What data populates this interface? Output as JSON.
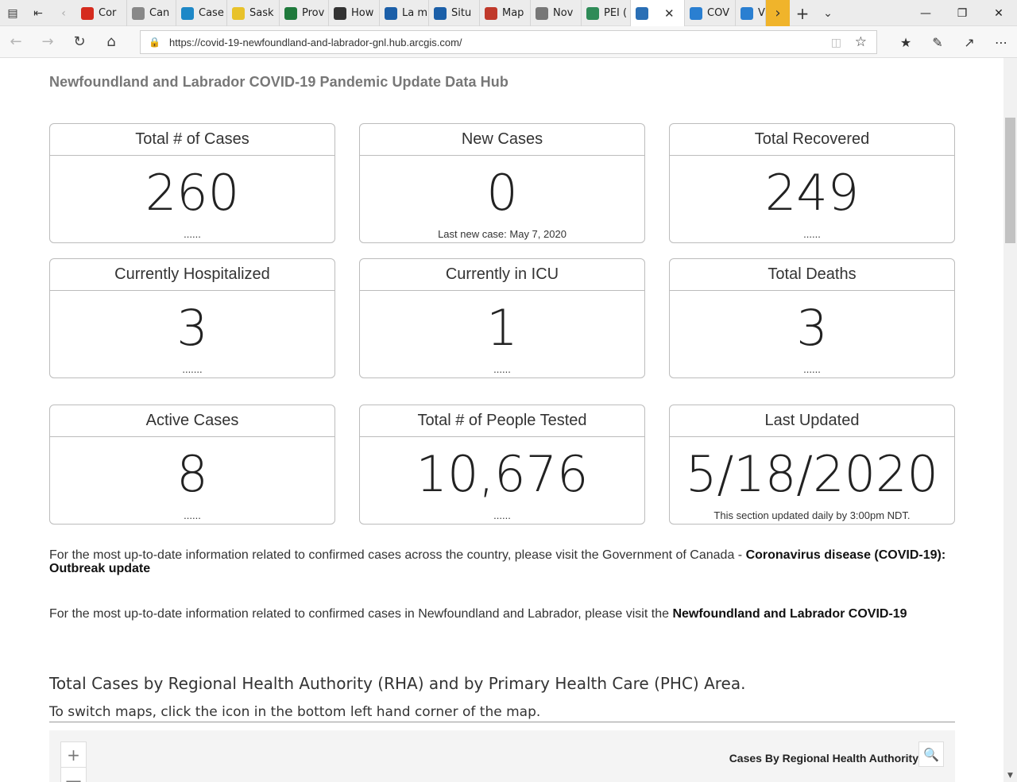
{
  "browser": {
    "tabs": [
      {
        "label": "Cor",
        "icon": "maple-leaf-icon",
        "color": "#d52b1e"
      },
      {
        "label": "Can",
        "icon": "page-icon",
        "color": "#888888"
      },
      {
        "label": "Case",
        "icon": "chart-icon",
        "color": "#1e88c7"
      },
      {
        "label": "Sask",
        "icon": "wheat-icon",
        "color": "#e8c22a"
      },
      {
        "label": "Prov",
        "icon": "provincial-logo-icon",
        "color": "#1f7a3c"
      },
      {
        "label": "How",
        "icon": "globe-dark-icon",
        "color": "#333333"
      },
      {
        "label": "La m",
        "icon": "fleur-de-lis-icon",
        "color": "#1b5fa8"
      },
      {
        "label": "Situ",
        "icon": "fleur-de-lis-icon",
        "color": "#1b5fa8"
      },
      {
        "label": "Map",
        "icon": "map-pen-icon",
        "color": "#c0392b"
      },
      {
        "label": "Nov",
        "icon": "document-icon",
        "color": "#777777"
      },
      {
        "label": "PEI (",
        "icon": "island-icon",
        "color": "#2e8b57"
      },
      {
        "label": "",
        "icon": "globe-icon",
        "color": "#2a6fb5",
        "active": true
      },
      {
        "label": "COV",
        "icon": "arcgis-icon",
        "color": "#2a7fd1"
      },
      {
        "label": "V",
        "icon": "arcgis-icon",
        "color": "#2a7fd1"
      }
    ],
    "url": "https://covid-19-newfoundland-and-labrador-gnl.hub.arcgis.com/"
  },
  "page": {
    "hub_title": "Newfoundland and Labrador COVID-19 Pandemic Update Data Hub",
    "cards": [
      {
        "title": "Total # of Cases",
        "value": "260",
        "note": "......"
      },
      {
        "title": "New Cases",
        "value": "0",
        "note": "Last new case: May 7, 2020"
      },
      {
        "title": "Total Recovered",
        "value": "249",
        "note": "......"
      },
      {
        "title": "Currently Hospitalized",
        "value": "3",
        "note": "......."
      },
      {
        "title": "Currently in ICU",
        "value": "1",
        "note": "......"
      },
      {
        "title": "Total Deaths",
        "value": "3",
        "note": "......"
      },
      {
        "title": "Active Cases",
        "value": "8",
        "note": "......"
      },
      {
        "title": "Total # of People Tested",
        "value": "10,676",
        "note": "......"
      },
      {
        "title": "Last Updated",
        "value": "5/18/2020",
        "note": "This section updated daily by 3:00pm NDT."
      }
    ],
    "para1_text": "For the most up-to-date information related to confirmed cases across the country, please visit the Government of Canada - ",
    "para1_link": "Coronavirus disease (COVID-19): Outbreak update",
    "para2_text": "For the most up-to-date information related to confirmed cases in Newfoundland and Labrador, please visit the ",
    "para2_link": "Newfoundland and Labrador COVID-19",
    "section_title": "Total Cases by Regional Health Authority (RHA) and by Primary Health Care (PHC) Area.",
    "section_sub": "To switch maps, click the icon in the bottom left hand corner of the map.",
    "map": {
      "title": "Cases By Regional Health Authority",
      "zoom_in": "+",
      "zoom_out": "—"
    }
  }
}
